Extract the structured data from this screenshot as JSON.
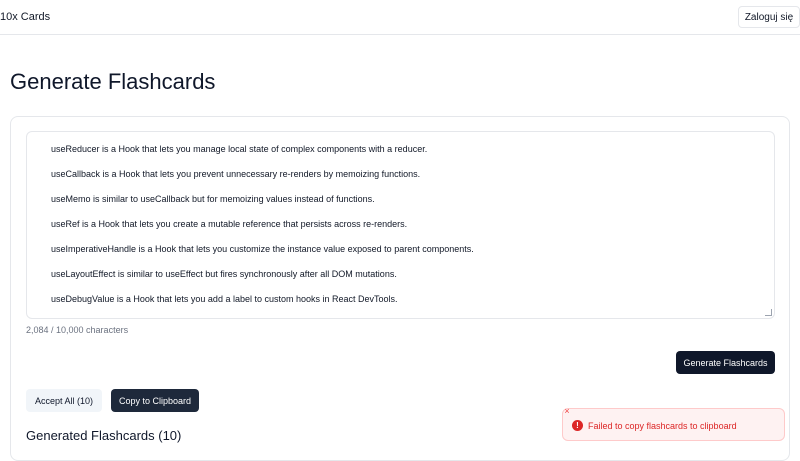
{
  "header": {
    "brand": "10x Cards",
    "login_label": "Zaloguj się"
  },
  "main": {
    "title": "Generate Flashcards",
    "source_lines": [
      "useReducer is a Hook that lets you manage local state of complex components with a reducer.",
      "useCallback is a Hook that lets you prevent unnecessary re-renders by memoizing functions.",
      "useMemo is similar to useCallback but for memoizing values instead of functions.",
      "useRef is a Hook that lets you create a mutable reference that persists across re-renders.",
      "useImperativeHandle is a Hook that lets you customize the instance value exposed to parent components.",
      "useLayoutEffect is similar to useEffect but fires synchronously after all DOM mutations.",
      "useDebugValue is a Hook that lets you add a label to custom hooks in React DevTools."
    ],
    "char_count": "2,084 / 10,000 characters",
    "generate_label": "Generate Flashcards",
    "accept_all_label": "Accept All (10)",
    "copy_label": "Copy to Clipboard",
    "generated_title": "Generated Flashcards (10)"
  },
  "toast": {
    "close_glyph": "×",
    "icon_glyph": "!",
    "message": "Failed to copy flashcards to clipboard",
    "type": "error"
  },
  "colors": {
    "primary": "#0f172a",
    "error": "#dc2626",
    "error_bg": "#fef2f2"
  }
}
